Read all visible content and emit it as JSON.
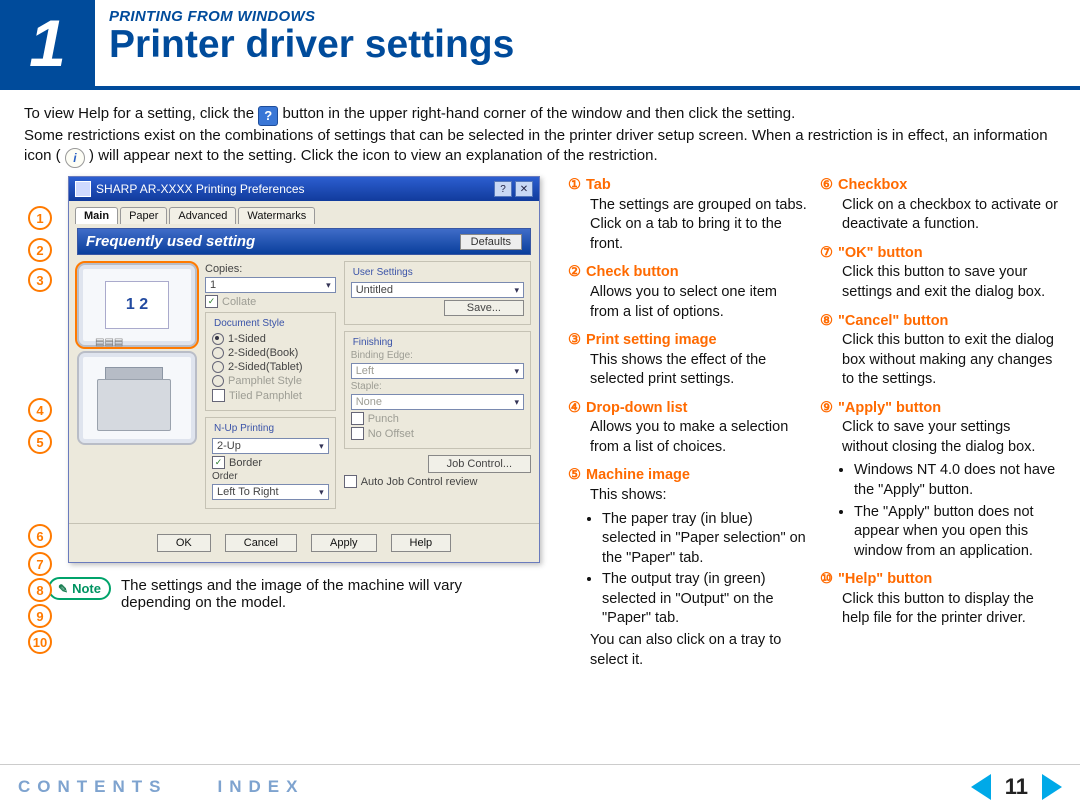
{
  "header": {
    "chapter_number": "1",
    "breadcrumb": "PRINTING FROM WINDOWS",
    "title": "Printer driver settings"
  },
  "intro": {
    "line1_a": "To view Help for a setting, click the ",
    "line1_b": " button in the upper right-hand corner of the window and then click the setting.",
    "line2": "Some restrictions exist on the combinations of settings that can be selected in the printer driver setup screen. When a restriction is in effect, an information icon ( ",
    "line2_b": " ) will appear next to the setting. Click the icon to view an explanation of the restriction."
  },
  "screenshot": {
    "window_title": "SHARP AR-XXXX Printing Preferences",
    "tabs": [
      "Main",
      "Paper",
      "Advanced",
      "Watermarks"
    ],
    "freq_label": "Frequently used setting",
    "defaults_btn": "Defaults",
    "copies_label": "Copies:",
    "copies_value": "1",
    "collate_label": "Collate",
    "doc_style_label": "Document Style",
    "doc_style_options": [
      "1-Sided",
      "2-Sided(Book)",
      "2-Sided(Tablet)",
      "Pamphlet Style"
    ],
    "tiled_label": "Tiled Pamphlet",
    "nup_label": "N-Up Printing",
    "nup_value": "2-Up",
    "border_label": "Border",
    "order_label": "Order",
    "order_value": "Left To Right",
    "user_settings_label": "User Settings",
    "user_settings_value": "Untitled",
    "save_btn": "Save...",
    "finishing_label": "Finishing",
    "binding_edge_label": "Binding Edge:",
    "binding_edge_value": "Left",
    "staple_label": "Staple:",
    "staple_value": "None",
    "punch_label": "Punch",
    "no_offset_label": "No Offset",
    "job_control_btn": "Job Control...",
    "auto_job_label": "Auto Job Control review",
    "footer_buttons": [
      "OK",
      "Cancel",
      "Apply",
      "Help"
    ],
    "preview_nums": "1  2"
  },
  "callouts": [
    "1",
    "2",
    "3",
    "4",
    "5",
    "6",
    "7",
    "8",
    "9",
    "10"
  ],
  "note_badge": "Note",
  "note_text": "The settings and the image of the machine will vary depending on the model.",
  "defs_left": [
    {
      "num": "①",
      "head": "Tab",
      "body": "The settings are grouped on tabs. Click on a tab to bring it to the front."
    },
    {
      "num": "②",
      "head": "Check button",
      "body": "Allows you to select one item from a list of options."
    },
    {
      "num": "③",
      "head": "Print setting image",
      "body": "This shows the effect of the selected print settings."
    },
    {
      "num": "④",
      "head": "Drop-down list",
      "body": "Allows you to make a selection from a list of choices."
    },
    {
      "num": "⑤",
      "head": "Machine image",
      "body": "This shows:",
      "bullets": [
        "The paper tray (in blue) selected in \"Paper selection\" on the \"Paper\" tab.",
        "The output tray (in green) selected in \"Output\" on the \"Paper\" tab."
      ],
      "tail": "You can also click on a tray to select it."
    }
  ],
  "defs_right": [
    {
      "num": "⑥",
      "head": "Checkbox",
      "body": "Click on a checkbox to activate or deactivate a function."
    },
    {
      "num": "⑦",
      "head": "\"OK\" button",
      "body": "Click this button to save your settings and exit the dialog box."
    },
    {
      "num": "⑧",
      "head": "\"Cancel\" button",
      "body": "Click this button to exit the dialog box without making any changes to the settings."
    },
    {
      "num": "⑨",
      "head": "\"Apply\" button",
      "body": "Click to save your settings without closing the dialog box.",
      "bullets": [
        "Windows NT 4.0 does not have the \"Apply\" button.",
        "The \"Apply\" button does not appear when you open this window from an application."
      ]
    },
    {
      "num": "⑩",
      "head": "\"Help\" button",
      "body": "Click this button to display the help file for the printer driver."
    }
  ],
  "footer": {
    "contents": "CONTENTS",
    "index": "INDEX",
    "page": "11"
  }
}
